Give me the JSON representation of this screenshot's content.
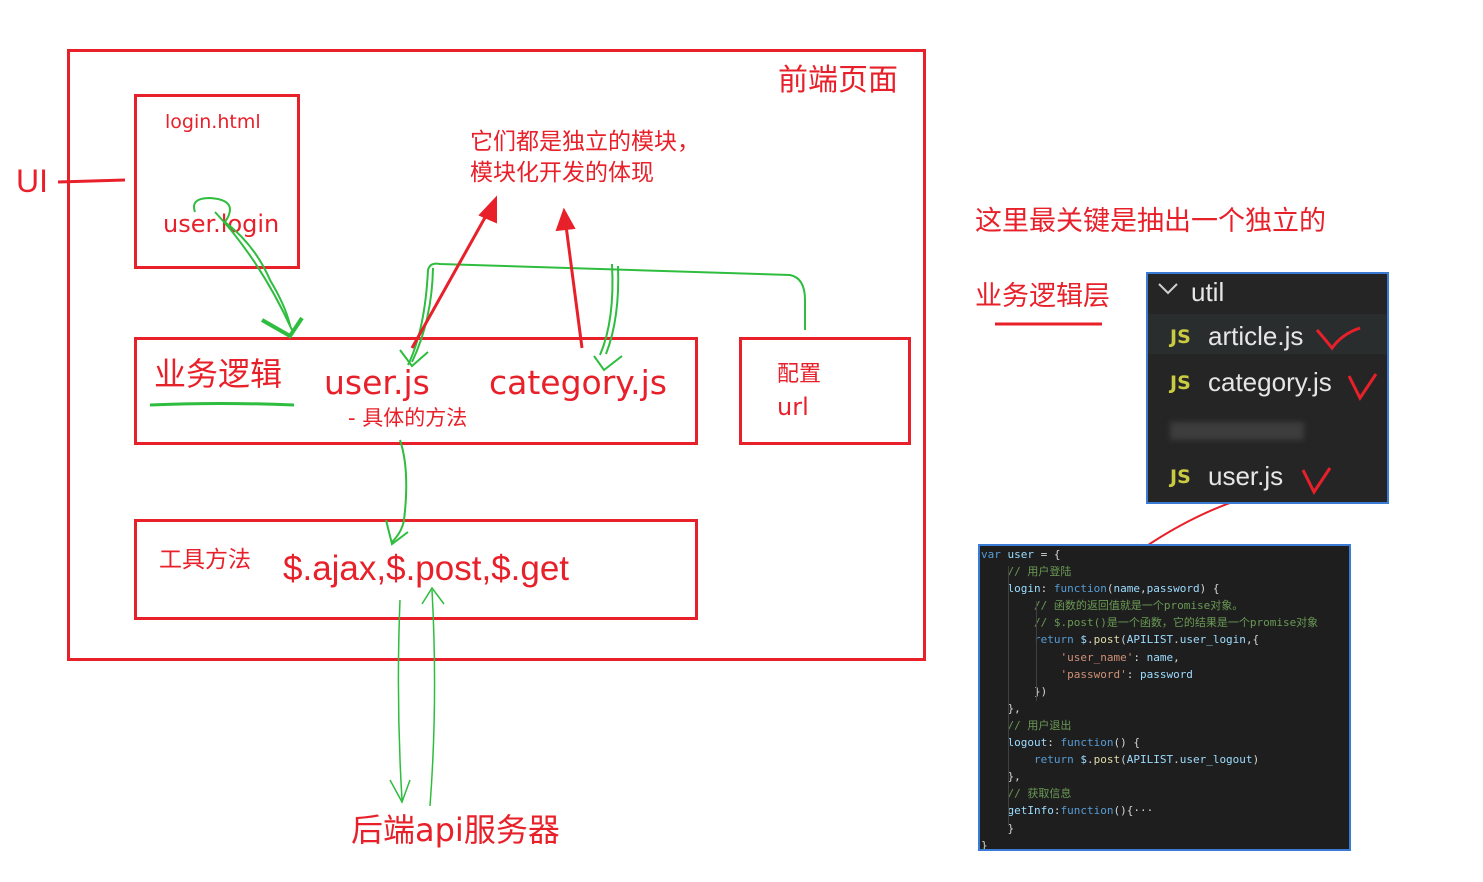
{
  "colors": {
    "annotation_red": "#e8202a",
    "arrow_green": "#2ebd3e",
    "panel_bg": "#252526",
    "code_bg": "#1e1e1e"
  },
  "frontend_label": "前端页面",
  "ui_label": "UI",
  "login_box": {
    "title": "login.html",
    "call": "user.login"
  },
  "business_box": {
    "title": "业务逻辑",
    "user_file": "user.js",
    "user_note": "- 具体的方法",
    "category_file": "category.js"
  },
  "config_box": {
    "line1": "配置",
    "line2": "url"
  },
  "tools_box": {
    "title": "工具方法",
    "methods": "$.ajax,$.post,$.get"
  },
  "backend_label": "后端api服务器",
  "modules_note": {
    "line1": "它们都是独立的模块，",
    "line2": "模块化开发的体现"
  },
  "key_note": {
    "line1": "这里最关键是抽出一个独立的",
    "line2": "业务逻辑层"
  },
  "explorer": {
    "folder": "util",
    "chevron_icon": "chevron-down-icon",
    "files": [
      {
        "icon": "JS",
        "name": "article.js"
      },
      {
        "icon": "JS",
        "name": "category.js"
      },
      {
        "icon": "JS",
        "name": "user.js"
      }
    ]
  },
  "code": [
    {
      "t": [
        [
          "kw",
          "var "
        ],
        [
          "var",
          "user"
        ],
        [
          "plain",
          " = {"
        ]
      ]
    },
    {
      "t": [
        [
          "cm",
          "    // 用户登陆"
        ]
      ]
    },
    {
      "t": [
        [
          "var",
          "    login"
        ],
        [
          "plain",
          ": "
        ],
        [
          "kw",
          "function"
        ],
        [
          "plain",
          "("
        ],
        [
          "var",
          "name"
        ],
        [
          "plain",
          ","
        ],
        [
          "var",
          "password"
        ],
        [
          "plain",
          ") {"
        ]
      ]
    },
    {
      "t": [
        [
          "cm",
          "        // 函数的返回值就是一个promise对象。"
        ]
      ]
    },
    {
      "t": [
        [
          "cm",
          "        // $.post()是一个函数，它的结果是一个promise对象"
        ]
      ]
    },
    {
      "t": [
        [
          "kw",
          "        return "
        ],
        [
          "var",
          "$"
        ],
        [
          "plain",
          "."
        ],
        [
          "fn",
          "post"
        ],
        [
          "plain",
          "("
        ],
        [
          "var",
          "APILIST"
        ],
        [
          "plain",
          "."
        ],
        [
          "var",
          "user_login"
        ],
        [
          "plain",
          ",{"
        ]
      ]
    },
    {
      "t": [
        [
          "str",
          "            'user_name'"
        ],
        [
          "plain",
          ": "
        ],
        [
          "var",
          "name"
        ],
        [
          "plain",
          ","
        ]
      ]
    },
    {
      "t": [
        [
          "str",
          "            'password'"
        ],
        [
          "plain",
          ": "
        ],
        [
          "var",
          "password"
        ]
      ]
    },
    {
      "t": [
        [
          "plain",
          "        })"
        ]
      ]
    },
    {
      "t": [
        [
          "plain",
          "    },"
        ]
      ]
    },
    {
      "t": [
        [
          "cm",
          "    // 用户退出"
        ]
      ]
    },
    {
      "t": [
        [
          "var",
          "    logout"
        ],
        [
          "plain",
          ": "
        ],
        [
          "kw",
          "function"
        ],
        [
          "plain",
          "() {"
        ]
      ]
    },
    {
      "t": [
        [
          "kw",
          "        return "
        ],
        [
          "var",
          "$"
        ],
        [
          "plain",
          "."
        ],
        [
          "fn",
          "post"
        ],
        [
          "plain",
          "("
        ],
        [
          "var",
          "APILIST"
        ],
        [
          "plain",
          "."
        ],
        [
          "var",
          "user_logout"
        ],
        [
          "plain",
          ")"
        ]
      ]
    },
    {
      "t": [
        [
          "plain",
          "    },"
        ]
      ]
    },
    {
      "t": [
        [
          "cm",
          "    // 获取信息"
        ]
      ]
    },
    {
      "t": [
        [
          "var",
          "    getInfo"
        ],
        [
          "plain",
          ":"
        ],
        [
          "kw",
          "function"
        ],
        [
          "plain",
          "(){···"
        ]
      ]
    },
    {
      "t": [
        [
          "plain",
          "    }"
        ]
      ]
    },
    {
      "t": [
        [
          "plain",
          "}"
        ]
      ]
    }
  ]
}
